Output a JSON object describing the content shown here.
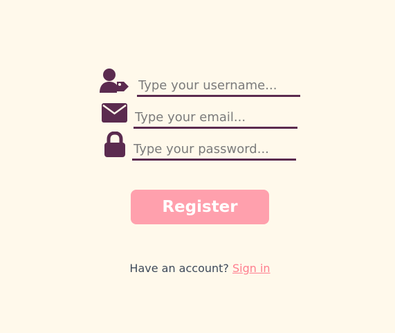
{
  "form": {
    "username": {
      "placeholder": "Type your username...",
      "value": "",
      "icon": "user-tag-icon"
    },
    "email": {
      "placeholder": "Type your email...",
      "value": "",
      "icon": "envelope-icon"
    },
    "password": {
      "placeholder": "Type your password...",
      "value": "",
      "icon": "lock-icon"
    },
    "register_label": "Register"
  },
  "footer": {
    "prompt": "Have an account?",
    "signin_label": "Sign in"
  },
  "colors": {
    "background": "#fff9eb",
    "icon_and_underline": "#5b2b4f",
    "button": "#ffa0ad",
    "link": "#ff7f8f",
    "text": "#3e4a5a"
  }
}
